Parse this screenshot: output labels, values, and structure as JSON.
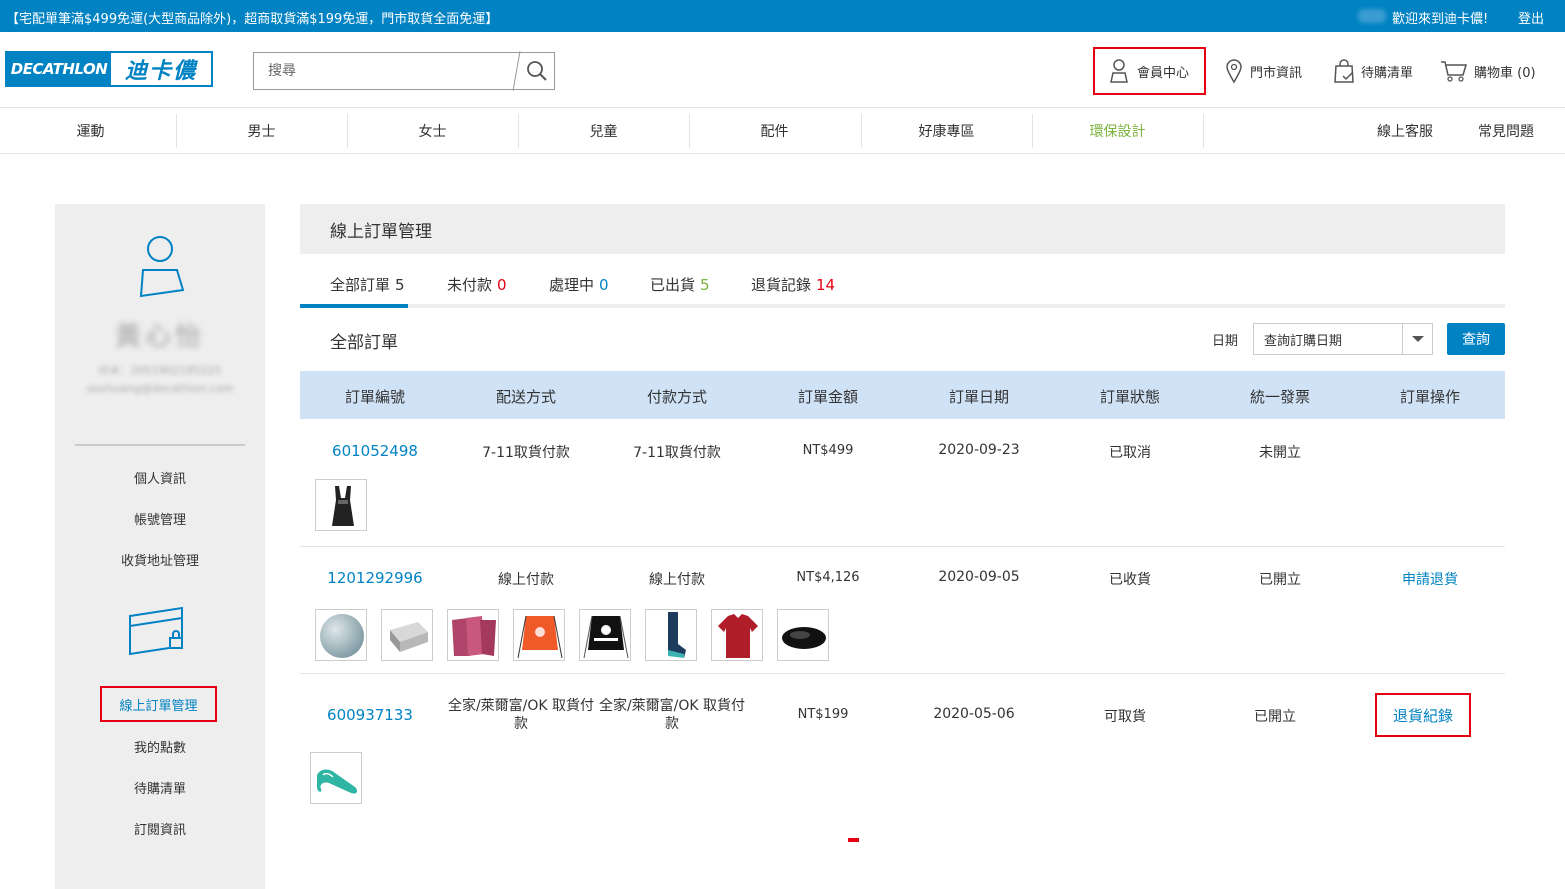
{
  "topbar": {
    "promo": "【宅配單筆滿$499免運(大型商品除外)，超商取貨滿$199免運，門市取貨全面免運】",
    "welcome": "歡迎來到迪卡儂!",
    "logout": "登出"
  },
  "header": {
    "logo_en": "DECATHLON",
    "logo_zh": "迪卡儂",
    "search_placeholder": "搜尋",
    "member_center": "會員中心",
    "store_info": "門市資訊",
    "wishlist": "待購清單",
    "cart": "購物車 (0)"
  },
  "categories": [
    "運動",
    "男士",
    "女士",
    "兒童",
    "配件",
    "好康專區",
    "環保設計"
  ],
  "nav_right": {
    "service": "線上客服",
    "faq": "常見問題"
  },
  "sidebar": {
    "user_name": "黃心怡",
    "user_id": "ID#：2051902185225",
    "user_email": "ooxhuang@decathlon.com",
    "items_account": [
      "個人資訊",
      "帳號管理",
      "收貨地址管理"
    ],
    "items_orders": [
      "線上訂單管理",
      "我的點數",
      "待購清單",
      "訂閱資訊"
    ]
  },
  "main": {
    "title": "線上訂單管理",
    "tabs": [
      {
        "label": "全部訂單",
        "count": "5",
        "color": "#333333"
      },
      {
        "label": "未付款",
        "count": "0",
        "color": "#e60012"
      },
      {
        "label": "處理中",
        "count": "0",
        "color": "#0082c3"
      },
      {
        "label": "已出貨",
        "count": "5",
        "color": "#7ab33c"
      },
      {
        "label": "退貨記錄",
        "count": "14",
        "color": "#e60012"
      }
    ],
    "section_title": "全部訂單",
    "date_label": "日期",
    "date_select": "查詢訂購日期",
    "query_button": "查詢",
    "columns": [
      "訂單編號",
      "配送方式",
      "付款方式",
      "訂單金額",
      "訂單日期",
      "訂單狀態",
      "統一發票",
      "訂單操作"
    ],
    "orders": [
      {
        "id": "601052498",
        "shipping": "7-11取貨付款",
        "payment": "7-11取貨付款",
        "amount": "NT$499",
        "date": "2020-09-23",
        "status": "已取消",
        "invoice": "未開立",
        "action": ""
      },
      {
        "id": "1201292996",
        "shipping": "線上付款",
        "payment": "線上付款",
        "amount": "NT$4,126",
        "date": "2020-09-05",
        "status": "已收貨",
        "invoice": "已開立",
        "action": "申請退貨"
      },
      {
        "id": "600937133",
        "shipping": "全家/萊爾富/OK 取貨付款",
        "payment": "全家/萊爾富/OK 取貨付款",
        "amount": "NT$199",
        "date": "2020-05-06",
        "status": "可取貨",
        "invoice": "已開立",
        "action": "退貨紀錄"
      }
    ]
  },
  "colors": {
    "brand": "#0082c3",
    "highlight": "#e60012",
    "eco": "#7ab33c",
    "table_header": "#cfe2f6"
  }
}
